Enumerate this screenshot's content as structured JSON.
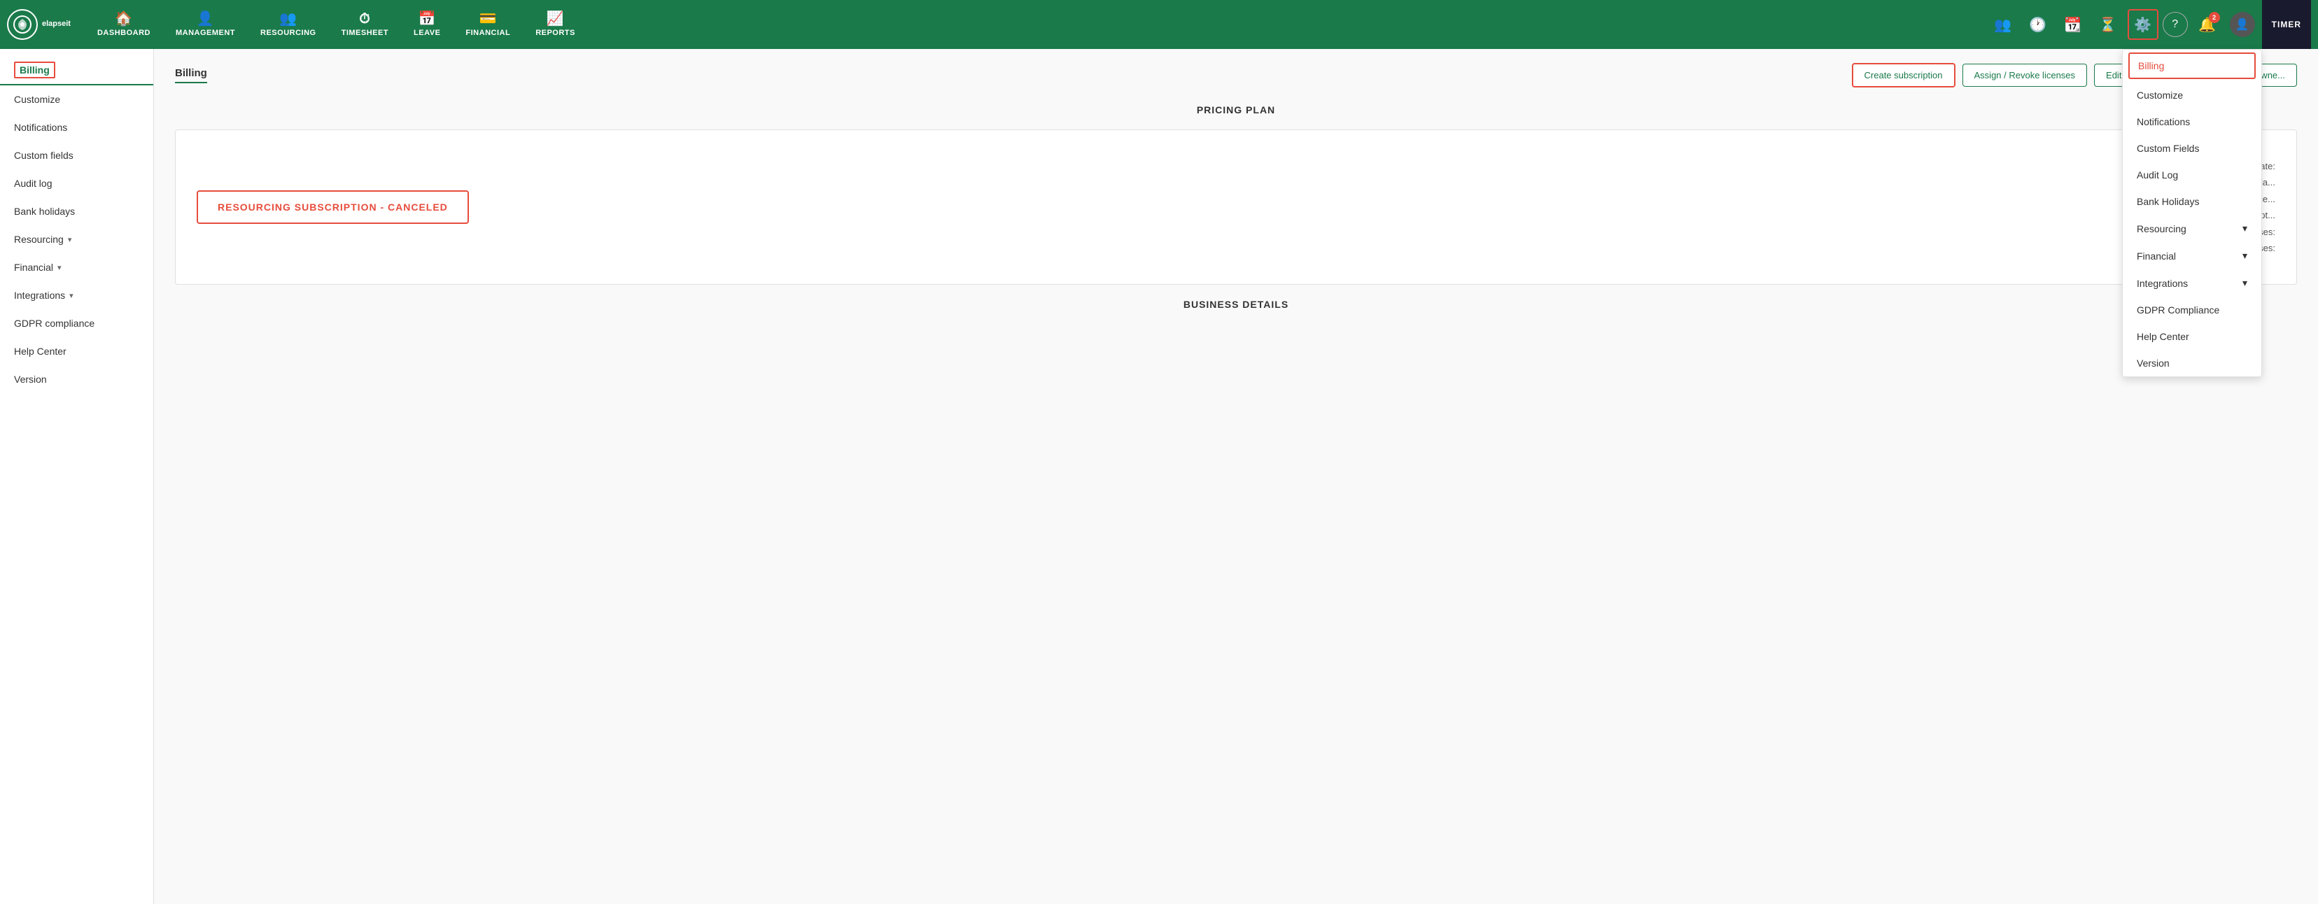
{
  "app": {
    "name": "elapseit"
  },
  "topnav": {
    "logo_text": "elapseit",
    "items": [
      {
        "label": "DASHBOARD",
        "icon": "🏠"
      },
      {
        "label": "MANAGEMENT",
        "icon": "👤"
      },
      {
        "label": "RESOURCING",
        "icon": "👥"
      },
      {
        "label": "TIMESHEET",
        "icon": "⏱"
      },
      {
        "label": "LEAVE",
        "icon": "📅"
      },
      {
        "label": "FINANCIAL",
        "icon": "💳"
      },
      {
        "label": "REPORTS",
        "icon": "📈"
      }
    ],
    "right_icons": [
      {
        "name": "people-icon",
        "symbol": "👥"
      },
      {
        "name": "clock-icon",
        "symbol": "🕐"
      },
      {
        "name": "calendar-icon",
        "symbol": "📆"
      },
      {
        "name": "hourglass-icon",
        "symbol": "⏳"
      },
      {
        "name": "gear-icon",
        "symbol": "⚙",
        "active": true
      },
      {
        "name": "help-icon",
        "symbol": "?"
      },
      {
        "name": "notification-icon",
        "symbol": "🔔",
        "badge": "2"
      },
      {
        "name": "user-icon",
        "symbol": "👤"
      }
    ],
    "timer_label": "TIMER"
  },
  "sidebar": {
    "items": [
      {
        "label": "Billing",
        "active": true,
        "outlined": true
      },
      {
        "label": "Customize"
      },
      {
        "label": "Notifications"
      },
      {
        "label": "Custom fields"
      },
      {
        "label": "Audit log"
      },
      {
        "label": "Bank holidays"
      },
      {
        "label": "Resourcing",
        "chevron": "▾"
      },
      {
        "label": "Financial",
        "chevron": "▾"
      },
      {
        "label": "Integrations",
        "chevron": "▾"
      },
      {
        "label": "GDPR compliance"
      },
      {
        "label": "Help Center"
      },
      {
        "label": "Version"
      }
    ]
  },
  "content": {
    "title": "Billing",
    "buttons": [
      {
        "label": "Create subscription",
        "highlighted": true
      },
      {
        "label": "Assign / Revoke licenses"
      },
      {
        "label": "Edit business details"
      },
      {
        "label": "Transfer owne..."
      }
    ],
    "pricing_plan_title": "PRICING PLAN",
    "subscription_badge": "RESOURCING SUBSCRIPTION - CANCELED",
    "subscription_info": [
      "Registered date:",
      "Next invoicing da...",
      "Monthly user lice...",
      "Monthly subscript...",
      "Available licenses:",
      "Assigned licenses:"
    ],
    "business_details_title": "BUSINESS DETAILS"
  },
  "dropdown": {
    "items": [
      {
        "label": "Billing",
        "active": true
      },
      {
        "label": "Customize"
      },
      {
        "label": "Notifications"
      },
      {
        "label": "Custom Fields"
      },
      {
        "label": "Audit Log"
      },
      {
        "label": "Bank Holidays"
      },
      {
        "label": "Resourcing",
        "chevron": "▾"
      },
      {
        "label": "Financial",
        "chevron": "▾"
      },
      {
        "label": "Integrations",
        "chevron": "▾"
      },
      {
        "label": "GDPR Compliance"
      },
      {
        "label": "Help Center"
      },
      {
        "label": "Version"
      }
    ]
  }
}
